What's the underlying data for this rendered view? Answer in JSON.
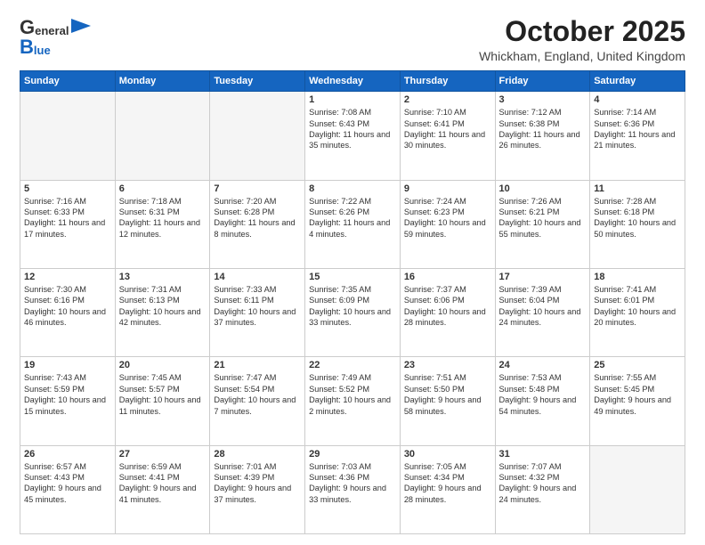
{
  "header": {
    "logo_general": "General",
    "logo_blue": "Blue",
    "month_title": "October 2025",
    "location": "Whickham, England, United Kingdom"
  },
  "days_of_week": [
    "Sunday",
    "Monday",
    "Tuesday",
    "Wednesday",
    "Thursday",
    "Friday",
    "Saturday"
  ],
  "weeks": [
    [
      {
        "day": "",
        "empty": true
      },
      {
        "day": "",
        "empty": true
      },
      {
        "day": "",
        "empty": true
      },
      {
        "day": "1",
        "sunrise": "7:08 AM",
        "sunset": "6:43 PM",
        "daylight": "11 hours and 35 minutes."
      },
      {
        "day": "2",
        "sunrise": "7:10 AM",
        "sunset": "6:41 PM",
        "daylight": "11 hours and 30 minutes."
      },
      {
        "day": "3",
        "sunrise": "7:12 AM",
        "sunset": "6:38 PM",
        "daylight": "11 hours and 26 minutes."
      },
      {
        "day": "4",
        "sunrise": "7:14 AM",
        "sunset": "6:36 PM",
        "daylight": "11 hours and 21 minutes."
      }
    ],
    [
      {
        "day": "5",
        "sunrise": "7:16 AM",
        "sunset": "6:33 PM",
        "daylight": "11 hours and 17 minutes."
      },
      {
        "day": "6",
        "sunrise": "7:18 AM",
        "sunset": "6:31 PM",
        "daylight": "11 hours and 12 minutes."
      },
      {
        "day": "7",
        "sunrise": "7:20 AM",
        "sunset": "6:28 PM",
        "daylight": "11 hours and 8 minutes."
      },
      {
        "day": "8",
        "sunrise": "7:22 AM",
        "sunset": "6:26 PM",
        "daylight": "11 hours and 4 minutes."
      },
      {
        "day": "9",
        "sunrise": "7:24 AM",
        "sunset": "6:23 PM",
        "daylight": "10 hours and 59 minutes."
      },
      {
        "day": "10",
        "sunrise": "7:26 AM",
        "sunset": "6:21 PM",
        "daylight": "10 hours and 55 minutes."
      },
      {
        "day": "11",
        "sunrise": "7:28 AM",
        "sunset": "6:18 PM",
        "daylight": "10 hours and 50 minutes."
      }
    ],
    [
      {
        "day": "12",
        "sunrise": "7:30 AM",
        "sunset": "6:16 PM",
        "daylight": "10 hours and 46 minutes."
      },
      {
        "day": "13",
        "sunrise": "7:31 AM",
        "sunset": "6:13 PM",
        "daylight": "10 hours and 42 minutes."
      },
      {
        "day": "14",
        "sunrise": "7:33 AM",
        "sunset": "6:11 PM",
        "daylight": "10 hours and 37 minutes."
      },
      {
        "day": "15",
        "sunrise": "7:35 AM",
        "sunset": "6:09 PM",
        "daylight": "10 hours and 33 minutes."
      },
      {
        "day": "16",
        "sunrise": "7:37 AM",
        "sunset": "6:06 PM",
        "daylight": "10 hours and 28 minutes."
      },
      {
        "day": "17",
        "sunrise": "7:39 AM",
        "sunset": "6:04 PM",
        "daylight": "10 hours and 24 minutes."
      },
      {
        "day": "18",
        "sunrise": "7:41 AM",
        "sunset": "6:01 PM",
        "daylight": "10 hours and 20 minutes."
      }
    ],
    [
      {
        "day": "19",
        "sunrise": "7:43 AM",
        "sunset": "5:59 PM",
        "daylight": "10 hours and 15 minutes."
      },
      {
        "day": "20",
        "sunrise": "7:45 AM",
        "sunset": "5:57 PM",
        "daylight": "10 hours and 11 minutes."
      },
      {
        "day": "21",
        "sunrise": "7:47 AM",
        "sunset": "5:54 PM",
        "daylight": "10 hours and 7 minutes."
      },
      {
        "day": "22",
        "sunrise": "7:49 AM",
        "sunset": "5:52 PM",
        "daylight": "10 hours and 2 minutes."
      },
      {
        "day": "23",
        "sunrise": "7:51 AM",
        "sunset": "5:50 PM",
        "daylight": "9 hours and 58 minutes."
      },
      {
        "day": "24",
        "sunrise": "7:53 AM",
        "sunset": "5:48 PM",
        "daylight": "9 hours and 54 minutes."
      },
      {
        "day": "25",
        "sunrise": "7:55 AM",
        "sunset": "5:45 PM",
        "daylight": "9 hours and 49 minutes."
      }
    ],
    [
      {
        "day": "26",
        "sunrise": "6:57 AM",
        "sunset": "4:43 PM",
        "daylight": "9 hours and 45 minutes."
      },
      {
        "day": "27",
        "sunrise": "6:59 AM",
        "sunset": "4:41 PM",
        "daylight": "9 hours and 41 minutes."
      },
      {
        "day": "28",
        "sunrise": "7:01 AM",
        "sunset": "4:39 PM",
        "daylight": "9 hours and 37 minutes."
      },
      {
        "day": "29",
        "sunrise": "7:03 AM",
        "sunset": "4:36 PM",
        "daylight": "9 hours and 33 minutes."
      },
      {
        "day": "30",
        "sunrise": "7:05 AM",
        "sunset": "4:34 PM",
        "daylight": "9 hours and 28 minutes."
      },
      {
        "day": "31",
        "sunrise": "7:07 AM",
        "sunset": "4:32 PM",
        "daylight": "9 hours and 24 minutes."
      },
      {
        "day": "",
        "empty": true
      }
    ]
  ]
}
